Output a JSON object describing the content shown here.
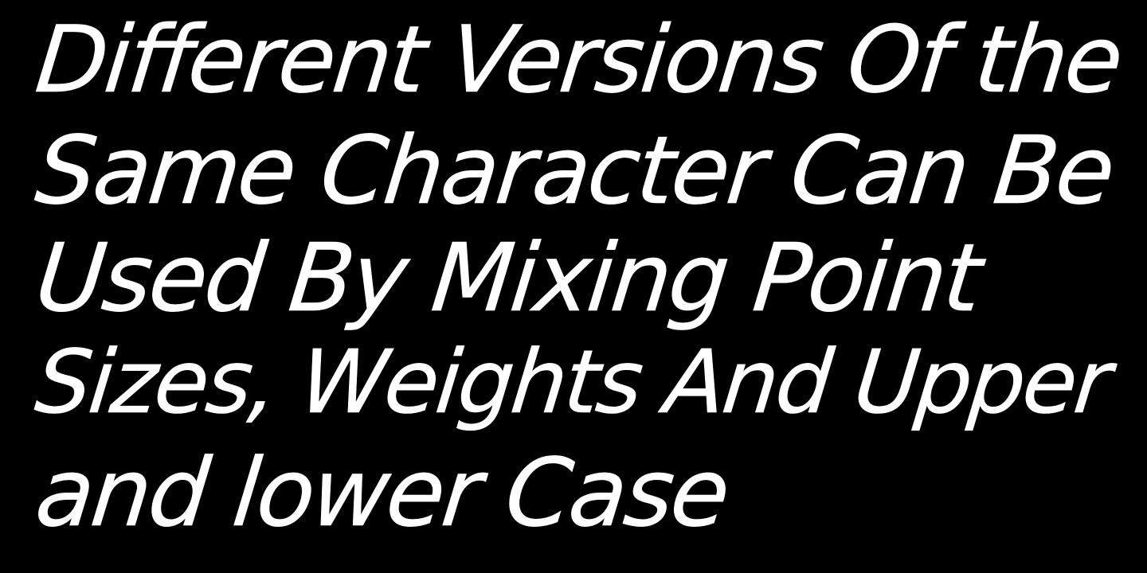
{
  "lines": [
    "Different Versions Of the",
    "Same Character Can Be",
    "Used By Mixing Point",
    "Sizes, Weights And Upper",
    "and lower Case"
  ],
  "colors": {
    "background": "#000000",
    "text": "#ffffff"
  }
}
